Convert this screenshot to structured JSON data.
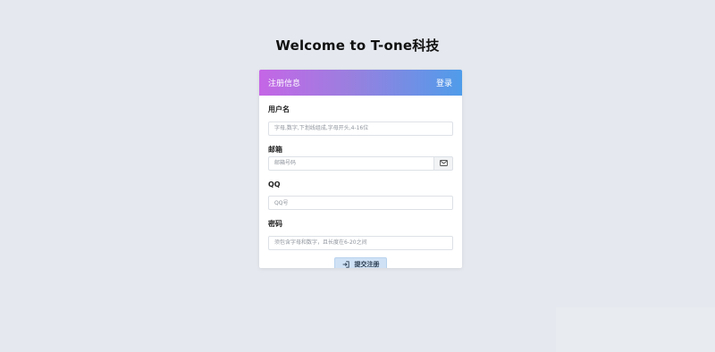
{
  "page": {
    "title": "Welcome to T-one科技"
  },
  "card": {
    "header_title": "注册信息",
    "login_link": "登录"
  },
  "form": {
    "username": {
      "label": "用户名",
      "placeholder": "字母,数字,下划线组成,字母开头,4-16位",
      "value": ""
    },
    "email": {
      "label": "邮箱",
      "placeholder": "邮箱号码",
      "value": "",
      "addon_icon": "envelope-icon"
    },
    "qq": {
      "label": "QQ",
      "placeholder": "QQ号",
      "value": ""
    },
    "password": {
      "label": "密码",
      "placeholder": "须包含字母和数字，且长度在6-20之间",
      "value": ""
    },
    "submit": {
      "label": "提交注册",
      "icon": "sign-in-icon"
    }
  },
  "colors": {
    "background": "#e5e8ee",
    "header_gradient_start": "#c566e6",
    "header_gradient_end": "#4f9cea",
    "submit_bg": "#cfe2f5"
  }
}
